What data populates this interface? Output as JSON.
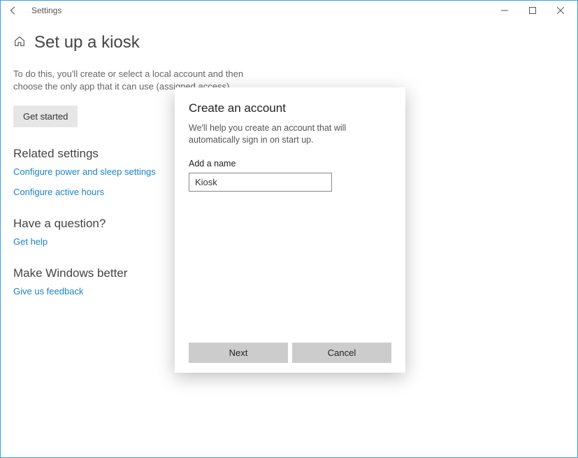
{
  "titlebar": {
    "title": "Settings"
  },
  "page": {
    "title": "Set up a kiosk",
    "description": "To do this, you'll create or select a local account and then choose the only app that it can use (assigned access).",
    "getStartedLabel": "Get started"
  },
  "relatedSettings": {
    "title": "Related settings",
    "links": [
      "Configure power and sleep settings",
      "Configure active hours"
    ]
  },
  "haveQuestion": {
    "title": "Have a question?",
    "link": "Get help"
  },
  "makeBetter": {
    "title": "Make Windows better",
    "link": "Give us feedback"
  },
  "dialog": {
    "title": "Create an account",
    "description": "We'll help you create an account that will automatically sign in on start up.",
    "fieldLabel": "Add a name",
    "nameValue": "Kiosk",
    "nextLabel": "Next",
    "cancelLabel": "Cancel"
  }
}
